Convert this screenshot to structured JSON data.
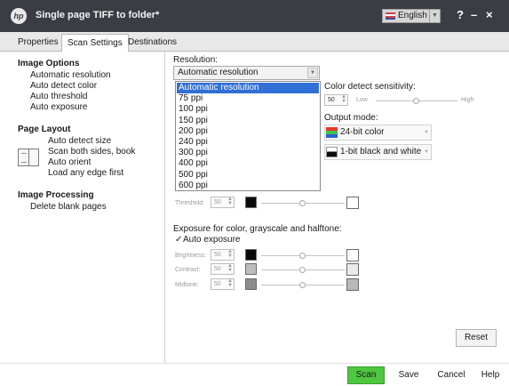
{
  "window": {
    "title": "Single page TIFF to folder*",
    "logo_text": "hp",
    "language": "English",
    "help_glyph": "?",
    "minimize_glyph": "–",
    "close_glyph": "×"
  },
  "tabs": [
    {
      "label": "Properties"
    },
    {
      "label": "Scan Settings",
      "active": true
    },
    {
      "label": "Destinations"
    }
  ],
  "sidebar": {
    "image_options": {
      "heading": "Image Options",
      "items": [
        "Automatic resolution",
        "Auto detect color",
        "Auto threshold",
        "Auto exposure"
      ]
    },
    "page_layout": {
      "heading": "Page Layout",
      "items": [
        "Auto detect size",
        "Scan both sides, book",
        "Auto orient",
        "Load any edge first"
      ]
    },
    "image_processing": {
      "heading": "Image Processing",
      "items": [
        "Delete blank pages"
      ]
    }
  },
  "resolution": {
    "label": "Resolution:",
    "selected": "Automatic resolution",
    "options": [
      "Automatic resolution",
      "75 ppi",
      "100 ppi",
      "150 ppi",
      "200 ppi",
      "240 ppi",
      "300 ppi",
      "400 ppi",
      "500 ppi",
      "600 ppi"
    ]
  },
  "color_detect": {
    "label": "Color detect sensitivity:",
    "value": "50",
    "low_label": "Low",
    "high_label": "High",
    "level": 0.5
  },
  "output_mode": {
    "label": "Output mode:",
    "color_option": "24-bit color",
    "bw_option": "1-bit black and white"
  },
  "threshold": {
    "label": "Threshold:",
    "value": "50",
    "level": 0.5
  },
  "exposure": {
    "heading": "Exposure for color, grayscale and halftone:",
    "auto_label": "Auto exposure",
    "auto_checked": true,
    "check_glyph": "✓",
    "rows": [
      {
        "label": "Brightness:",
        "value": "50",
        "level": 0.5,
        "dark": "#0a0a0a",
        "light": "#ffffff"
      },
      {
        "label": "Contrast:",
        "value": "50",
        "level": 0.5,
        "dark": "#bdbdbd",
        "light": "#eaeaea"
      },
      {
        "label": "Midtone:",
        "value": "50",
        "level": 0.5,
        "dark": "#8b8b8b",
        "light": "#b8b8b8"
      }
    ]
  },
  "buttons": {
    "reset": "Reset",
    "scan": "Scan",
    "save": "Save",
    "cancel": "Cancel",
    "help": "Help"
  },
  "colors": {
    "titlebar": "#3b3d44",
    "scan_button": "#4fc63f",
    "selection": "#2f6fd6"
  }
}
